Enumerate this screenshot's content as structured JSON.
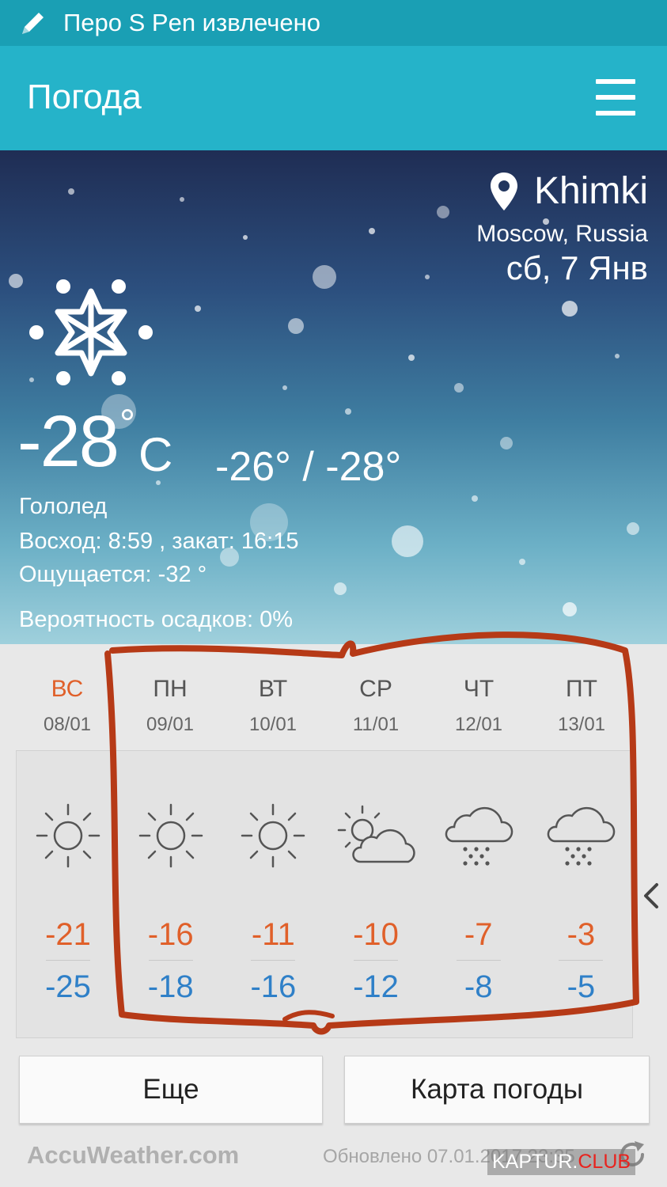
{
  "status_bar": {
    "text": "Перо S Pen извлечено",
    "icon": "pen-icon"
  },
  "app_bar": {
    "title": "Погода",
    "menu_icon": "hamburger-menu-icon"
  },
  "current": {
    "city": "Khimki",
    "region": "Moscow, Russia",
    "date": "сб, 7 Янв",
    "temperature": "-28",
    "degree": "°",
    "unit": "C",
    "range": "-26° / -28°",
    "condition": "Гололед",
    "sun": "Восход: 8:59 , закат: 16:15",
    "feels_like": "Ощущается: -32 °",
    "precip": "Вероятность осадков: 0%",
    "icon": "snowflake-icon"
  },
  "forecast": [
    {
      "day": "ВС",
      "date": "08/01",
      "high": "-21",
      "low": "-25",
      "icon": "sun-icon",
      "highlight": true
    },
    {
      "day": "ПН",
      "date": "09/01",
      "high": "-16",
      "low": "-18",
      "icon": "sun-icon"
    },
    {
      "day": "ВТ",
      "date": "10/01",
      "high": "-11",
      "low": "-16",
      "icon": "sun-icon"
    },
    {
      "day": "СР",
      "date": "11/01",
      "high": "-10",
      "low": "-12",
      "icon": "partly-cloudy-icon"
    },
    {
      "day": "ЧТ",
      "date": "12/01",
      "high": "-7",
      "low": "-8",
      "icon": "snow-cloud-icon"
    },
    {
      "day": "ПТ",
      "date": "13/01",
      "high": "-3",
      "low": "-5",
      "icon": "snow-cloud-icon"
    }
  ],
  "buttons": {
    "more": "Еще",
    "map": "Карта погоды"
  },
  "footer": {
    "brand": "AccuWeather.com",
    "updated": "Обновлено 07.01.2017 23:35",
    "watermark_main": "KAPTUR.",
    "watermark_club": "CLUB"
  },
  "colors": {
    "status_bar": "#1a9fb4",
    "app_bar": "#25b3c9",
    "high_temp": "#e0602a",
    "low_temp": "#2f80c8",
    "annotation": "#b63a17"
  }
}
